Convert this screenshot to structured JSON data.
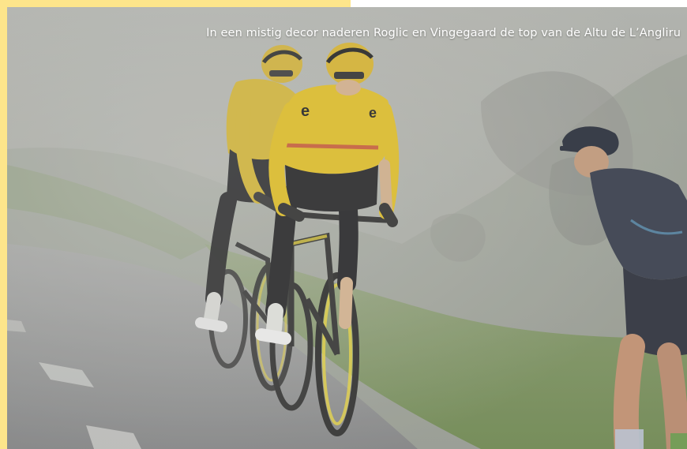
{
  "photo": {
    "caption": "In een mistig decor naderen Roglic en Vingegaard de top van de Altu de L’Angliru"
  },
  "colors": {
    "accent": "#fde58b",
    "fog": "#9fa39c",
    "road": "#8b8c8d",
    "grass": "#6e8a44",
    "jersey_yellow": "#e8c21a",
    "shorts_black": "#1e1e22",
    "spectator_navy": "#2b3040"
  }
}
